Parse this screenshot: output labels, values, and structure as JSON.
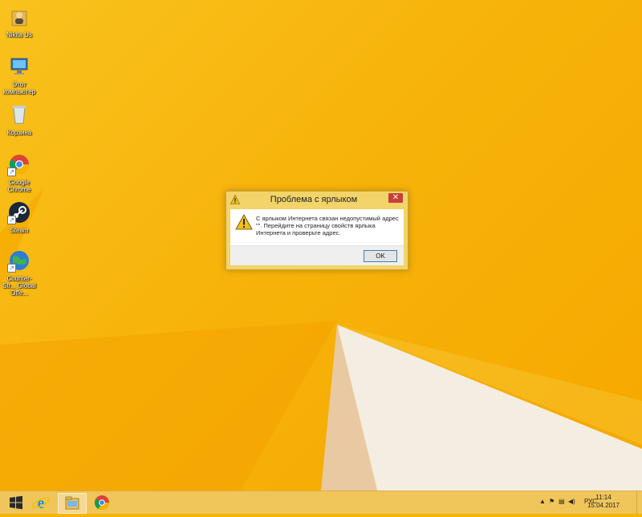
{
  "desktop": {
    "icons": [
      {
        "label": "Nikita Us",
        "icon": "user-folder-icon"
      },
      {
        "label": "Этот компьютер",
        "icon": "computer-icon"
      },
      {
        "label": "Корзина",
        "icon": "recycle-bin-icon"
      },
      {
        "label": "Google Chrome",
        "icon": "chrome-icon"
      },
      {
        "label": "Steam",
        "icon": "steam-icon"
      },
      {
        "label": "Counter-Str... Global Offe...",
        "icon": "globe-shortcut-icon"
      }
    ]
  },
  "dialog": {
    "title": "Проблема с ярлыком",
    "message": "С ярлыком Интернета связан недопустимый адрес \"\". Перейдите на страницу свойств ярлыка Интернета и проверьте адрес.",
    "ok_label": "OK",
    "close_glyph": "✕"
  },
  "taskbar": {
    "language": "РУС",
    "time": "11:14",
    "date": "15.04.2017"
  },
  "colors": {
    "desktop_accent": "#f7b400",
    "taskbar": "#f0c55a",
    "close_button": "#c7403a"
  }
}
